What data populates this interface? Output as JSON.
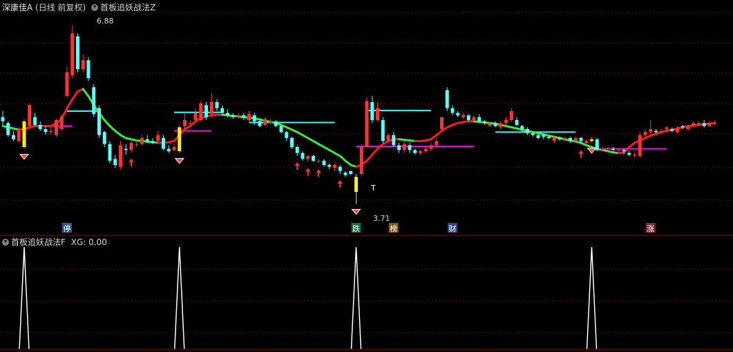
{
  "header": {
    "stock_name": "深康佳A",
    "period": "(日线 前复权)",
    "indicator_main": "首板追妖战法Z"
  },
  "sub_header": {
    "indicator_sub": "首板追妖战法F",
    "xg_label": "XG: 0.00"
  },
  "annotations": {
    "high_label": "6.88",
    "low_label": "3.71",
    "t_mark": "T"
  },
  "event_labels": [
    "停",
    "跌",
    "榜",
    "财",
    "涨"
  ],
  "colors": {
    "up": "#ff3232",
    "down": "#54ffff",
    "ma_up": "#ff1a1a",
    "ma_down": "#33ee33",
    "resistance": "#33ffff",
    "support": "#ff00ff",
    "signal": "#ffffff",
    "divider": "#aa0000",
    "grid": "#7a0000"
  },
  "chart_data": {
    "type": "candlestick",
    "title": "首板追妖战法Z",
    "ylim": [
      3.5,
      7.1
    ],
    "candles": [
      [
        5.35,
        5.28,
        5.45,
        5.22
      ],
      [
        5.25,
        5.05,
        5.28,
        5.02
      ],
      [
        5.05,
        4.98,
        5.12,
        4.95
      ],
      [
        4.95,
        5.12,
        5.18,
        4.92
      ],
      [
        4.85,
        5.28,
        5.32,
        4.82
      ],
      [
        5.2,
        5.55,
        5.58,
        5.15
      ],
      [
        5.35,
        5.22,
        5.42,
        5.2
      ],
      [
        5.22,
        5.15,
        5.28,
        5.12
      ],
      [
        5.15,
        5.1,
        5.2,
        5.05
      ],
      [
        5.1,
        5.12,
        5.18,
        5.05
      ],
      [
        5.05,
        5.3,
        5.32,
        5.02
      ],
      [
        5.15,
        5.36,
        5.4,
        5.12
      ],
      [
        5.7,
        6.1,
        6.2,
        5.7
      ],
      [
        6.05,
        6.75,
        6.88,
        6.0
      ],
      [
        6.7,
        6.15,
        6.75,
        6.1
      ],
      [
        6.15,
        6.3,
        6.4,
        6.1
      ],
      [
        6.3,
        6.0,
        6.35,
        5.95
      ],
      [
        5.85,
        5.4,
        5.9,
        5.35
      ],
      [
        5.5,
        5.05,
        5.55,
        5.0
      ],
      [
        5.1,
        4.9,
        5.12,
        4.85
      ],
      [
        4.9,
        4.62,
        4.95,
        4.58
      ],
      [
        4.65,
        4.55,
        4.72,
        4.5
      ],
      [
        4.52,
        4.88,
        4.95,
        4.48
      ],
      [
        4.82,
        4.8,
        4.9,
        4.72
      ],
      [
        4.8,
        4.92,
        4.98,
        4.76
      ],
      [
        4.9,
        4.9,
        4.98,
        4.85
      ],
      [
        4.9,
        5.0,
        5.05,
        4.88
      ],
      [
        4.98,
        4.95,
        5.05,
        4.92
      ],
      [
        4.95,
        4.92,
        5.0,
        4.9
      ],
      [
        4.95,
        5.05,
        5.12,
        4.92
      ],
      [
        5.0,
        4.82,
        5.05,
        4.8
      ],
      [
        4.82,
        4.78,
        4.88,
        4.75
      ],
      [
        4.8,
        4.85,
        4.9,
        4.78
      ],
      [
        4.78,
        5.18,
        5.22,
        4.75
      ],
      [
        5.2,
        5.3,
        5.42,
        5.15
      ],
      [
        5.25,
        5.25,
        5.3,
        5.22
      ],
      [
        5.3,
        5.42,
        5.5,
        5.28
      ],
      [
        5.3,
        5.58,
        5.62,
        5.28
      ],
      [
        5.55,
        5.35,
        5.6,
        5.3
      ],
      [
        5.4,
        5.6,
        5.75,
        5.35
      ],
      [
        5.6,
        5.5,
        5.65,
        5.45
      ],
      [
        5.5,
        5.42,
        5.55,
        5.4
      ],
      [
        5.42,
        5.38,
        5.48,
        5.35
      ],
      [
        5.38,
        5.35,
        5.42,
        5.32
      ],
      [
        5.35,
        5.38,
        5.42,
        5.32
      ],
      [
        5.38,
        5.35,
        5.42,
        5.3
      ],
      [
        5.3,
        5.4,
        5.45,
        5.28
      ],
      [
        5.38,
        5.28,
        5.42,
        5.22
      ],
      [
        5.28,
        5.2,
        5.32,
        5.18
      ],
      [
        5.22,
        5.32,
        5.35,
        5.2
      ],
      [
        5.25,
        5.28,
        5.32,
        5.22
      ],
      [
        5.28,
        5.2,
        5.3,
        5.18
      ],
      [
        5.2,
        5.1,
        5.22,
        5.08
      ],
      [
        5.1,
        5.0,
        5.12,
        4.95
      ],
      [
        5.0,
        4.85,
        5.02,
        4.82
      ],
      [
        4.85,
        4.75,
        4.88,
        4.7
      ],
      [
        4.75,
        4.65,
        4.78,
        4.62
      ],
      [
        4.65,
        4.7,
        4.72,
        4.6
      ],
      [
        4.7,
        4.62,
        4.72,
        4.6
      ],
      [
        4.62,
        4.62,
        4.65,
        4.58
      ],
      [
        4.62,
        4.55,
        4.65,
        4.52
      ],
      [
        4.55,
        4.52,
        4.58,
        4.48
      ],
      [
        4.5,
        4.55,
        4.58,
        4.45
      ],
      [
        4.52,
        4.45,
        4.55,
        4.4
      ],
      [
        4.42,
        4.38,
        4.45,
        4.35
      ],
      [
        4.45,
        4.4,
        4.45,
        4.38
      ],
      [
        4.35,
        4.1,
        4.4,
        3.9
      ],
      [
        4.4,
        4.85,
        4.9,
        4.35
      ],
      [
        4.85,
        5.62,
        5.68,
        4.85
      ],
      [
        5.6,
        5.3,
        5.7,
        5.25
      ],
      [
        5.3,
        5.5,
        5.6,
        5.28
      ],
      [
        5.3,
        4.95,
        5.35,
        4.92
      ],
      [
        4.95,
        5.05,
        5.08,
        4.92
      ],
      [
        5.05,
        4.88,
        5.1,
        4.85
      ],
      [
        4.88,
        4.8,
        4.92,
        4.75
      ],
      [
        4.8,
        4.9,
        4.95,
        4.75
      ],
      [
        4.88,
        4.8,
        4.92,
        4.75
      ],
      [
        4.8,
        4.75,
        4.82,
        4.72
      ],
      [
        4.75,
        4.78,
        4.8,
        4.72
      ],
      [
        4.78,
        4.82,
        4.85,
        4.75
      ],
      [
        4.82,
        4.88,
        4.92,
        4.78
      ],
      [
        4.88,
        4.95,
        5.0,
        4.85
      ],
      [
        5.15,
        5.35,
        5.35,
        5.12
      ],
      [
        5.8,
        5.5,
        5.85,
        5.45
      ],
      [
        5.5,
        5.42,
        5.55,
        5.38
      ],
      [
        5.42,
        5.38,
        5.45,
        5.35
      ],
      [
        5.35,
        5.38,
        5.42,
        5.32
      ],
      [
        5.38,
        5.3,
        5.4,
        5.28
      ],
      [
        5.3,
        5.35,
        5.38,
        5.28
      ],
      [
        5.35,
        5.28,
        5.4,
        5.25
      ],
      [
        5.28,
        5.25,
        5.3,
        5.22
      ],
      [
        5.2,
        5.23,
        5.25,
        5.2
      ],
      [
        5.25,
        5.2,
        5.28,
        5.18
      ],
      [
        5.18,
        5.25,
        5.28,
        5.15
      ],
      [
        5.25,
        5.3,
        5.35,
        5.22
      ],
      [
        5.3,
        5.45,
        5.5,
        5.28
      ],
      [
        5.3,
        5.22,
        5.35,
        5.2
      ],
      [
        5.2,
        5.15,
        5.22,
        5.1
      ],
      [
        5.15,
        5.08,
        5.18,
        5.05
      ],
      [
        5.08,
        5.05,
        5.1,
        5.02
      ],
      [
        5.05,
        5.0,
        5.08,
        4.98
      ],
      [
        5.05,
        5.02,
        5.08,
        4.98
      ],
      [
        5.02,
        5.0,
        5.05,
        4.98
      ],
      [
        4.95,
        5.0,
        5.02,
        4.92
      ],
      [
        5.0,
        4.98,
        5.02,
        4.95
      ],
      [
        4.98,
        5.0,
        5.02,
        4.95
      ],
      [
        5.0,
        4.95,
        5.02,
        4.92
      ],
      [
        4.95,
        5.0,
        5.02,
        4.92
      ],
      [
        5.0,
        4.95,
        5.02,
        4.9
      ],
      [
        4.92,
        4.95,
        4.98,
        4.9
      ],
      [
        4.95,
        4.98,
        5.02,
        4.92
      ],
      [
        4.98,
        4.8,
        5.0,
        4.78
      ],
      [
        4.8,
        4.82,
        4.85,
        4.78
      ],
      [
        4.82,
        4.82,
        4.85,
        4.8
      ],
      [
        4.82,
        4.8,
        4.85,
        4.78
      ],
      [
        4.8,
        4.8,
        4.82,
        4.78
      ],
      [
        4.8,
        4.78,
        4.82,
        4.72
      ],
      [
        4.75,
        4.72,
        4.78,
        4.7
      ],
      [
        4.72,
        4.72,
        4.75,
        4.68
      ],
      [
        4.7,
        5.05,
        5.1,
        4.68
      ],
      [
        5.05,
        5.1,
        5.15,
        5.0
      ],
      [
        5.1,
        5.15,
        5.3,
        5.05
      ],
      [
        5.12,
        5.1,
        5.15,
        5.08
      ],
      [
        5.1,
        5.12,
        5.15,
        5.08
      ],
      [
        5.15,
        5.18,
        5.2,
        5.12
      ],
      [
        5.15,
        5.12,
        5.18,
        5.1
      ],
      [
        5.1,
        5.15,
        5.2,
        5.08
      ],
      [
        5.2,
        5.18,
        5.22,
        5.15
      ],
      [
        5.15,
        5.2,
        5.22,
        5.12
      ],
      [
        5.2,
        5.25,
        5.28,
        5.18
      ],
      [
        5.22,
        5.25,
        5.28,
        5.2
      ],
      [
        5.25,
        5.2,
        5.3,
        5.18
      ],
      [
        5.2,
        5.25,
        5.28,
        5.18
      ],
      [
        5.25,
        5.25,
        5.3,
        5.22
      ]
    ],
    "ma_line": [
      5.2,
      5.18,
      5.16,
      5.14,
      5.15,
      5.18,
      5.2,
      5.2,
      5.2,
      5.2,
      5.25,
      5.32,
      5.5,
      5.65,
      5.78,
      5.82,
      5.7,
      5.55,
      5.42,
      5.3,
      5.2,
      5.12,
      5.05,
      5.0,
      4.98,
      4.96,
      4.95,
      4.94,
      4.93,
      4.92,
      4.92,
      4.93,
      4.95,
      5.05,
      5.15,
      5.2,
      5.28,
      5.33,
      5.36,
      5.38,
      5.39,
      5.39,
      5.38,
      5.37,
      5.36,
      5.35,
      5.34,
      5.33,
      5.31,
      5.29,
      5.27,
      5.25,
      5.22,
      5.18,
      5.14,
      5.1,
      5.05,
      5.0,
      4.95,
      4.9,
      4.85,
      4.8,
      4.75,
      4.7,
      4.62,
      4.55,
      4.52,
      4.55,
      4.62,
      4.72,
      4.82,
      4.9,
      4.95,
      4.98,
      4.98,
      4.97,
      4.96,
      4.95,
      4.95,
      4.96,
      4.98,
      5.05,
      5.12,
      5.18,
      5.22,
      5.25,
      5.27,
      5.28,
      5.28,
      5.27,
      5.26,
      5.25,
      5.24,
      5.22,
      5.2,
      5.18,
      5.16,
      5.14,
      5.12,
      5.1,
      5.08,
      5.06,
      5.04,
      5.02,
      5.0,
      4.98,
      4.96,
      4.94,
      4.92,
      4.88,
      4.85,
      4.82,
      4.8,
      4.78,
      4.76,
      4.75,
      4.76,
      4.85,
      4.92,
      4.96,
      5.0,
      5.04,
      5.07,
      5.1,
      5.12,
      5.14,
      5.16,
      5.18,
      5.2,
      5.21,
      5.22,
      5.23,
      5.24,
      5.25
    ],
    "resistance_levels": [
      {
        "from": 12,
        "to": 18,
        "value": 5.45
      },
      {
        "from": 32,
        "to": 41,
        "value": 5.43
      },
      {
        "from": 46,
        "to": 62,
        "value": 5.26
      },
      {
        "from": 68,
        "to": 80,
        "value": 5.46
      },
      {
        "from": 92,
        "to": 107,
        "value": 5.1
      }
    ],
    "support_levels": [
      {
        "from": 9,
        "to": 13,
        "value": 5.2
      },
      {
        "from": 32,
        "to": 39,
        "value": 5.12
      },
      {
        "from": 66,
        "to": 88,
        "value": 4.86
      },
      {
        "from": 112,
        "to": 124,
        "value": 4.82
      }
    ],
    "signal_bars": [
      4,
      33,
      66,
      110
    ],
    "buy_arrows": [
      24,
      55,
      57,
      59,
      63,
      108
    ],
    "sub_chart": {
      "type": "line",
      "ylim": [
        0,
        1
      ],
      "peaks": [
        4,
        33,
        66,
        110
      ]
    }
  }
}
